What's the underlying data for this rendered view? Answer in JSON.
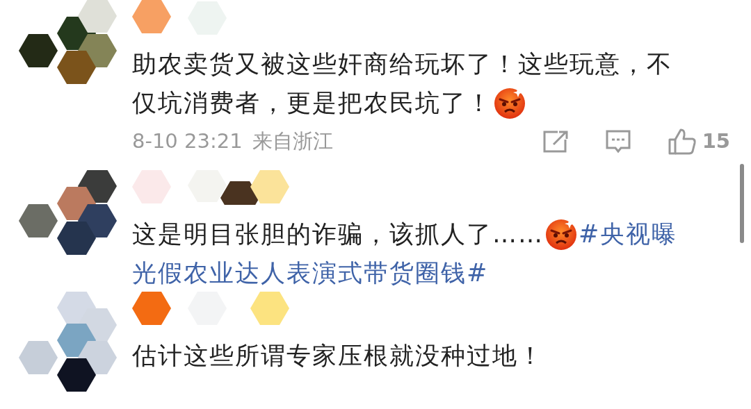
{
  "comments": [
    {
      "lines": [
        [
          {
            "kind": "text",
            "text": "助农卖货又被这些奸商给玩坏了！这些玩意，不"
          }
        ],
        [
          {
            "kind": "text",
            "text": "仅坑消费者，更是把农民坑了！"
          },
          {
            "kind": "emoji"
          }
        ]
      ],
      "meta": {
        "date": "8-10 23:21",
        "location": "来自浙江",
        "likes": "15"
      }
    },
    {
      "lines": [
        [
          {
            "kind": "text",
            "text": "这是明目张胆的诈骗，该抓人了……"
          },
          {
            "kind": "emoji"
          },
          {
            "kind": "hashtag",
            "text": "#央视曝"
          }
        ],
        [
          {
            "kind": "hashtag",
            "text": "光假农业达人表演式带货圈钱#"
          }
        ]
      ]
    },
    {
      "lines": [
        [
          {
            "kind": "text",
            "text": "估计这些所谓专家压根就没种过地！"
          }
        ]
      ]
    }
  ]
}
